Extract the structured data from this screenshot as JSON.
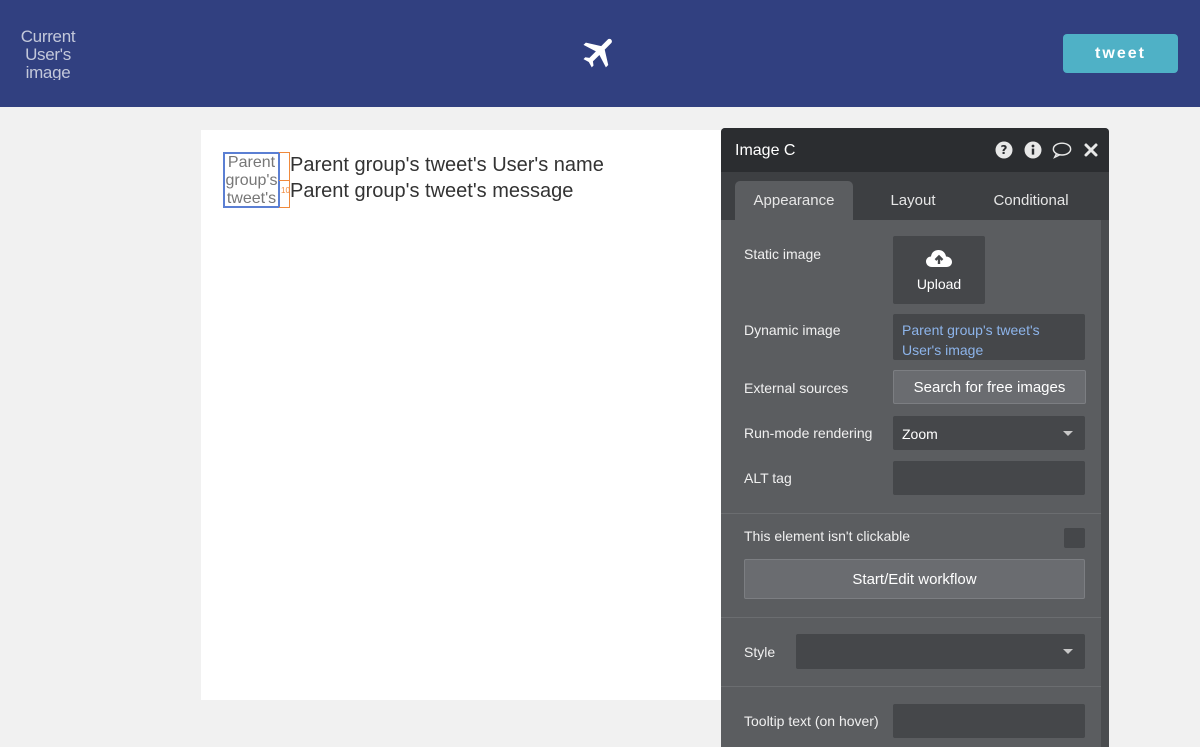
{
  "header": {
    "user_image_text": "Current User's image",
    "logo_icon": "airplane-icon",
    "tweet_button": "tweet"
  },
  "canvas": {
    "thumb_text": "Parent group's tweet's",
    "selection_number": "10",
    "name_text": "Parent group's tweet's User's name",
    "message_text": "Parent group's tweet's message"
  },
  "panel": {
    "title": "Image C",
    "tabs": [
      "Appearance",
      "Layout",
      "Conditional"
    ],
    "static_image_label": "Static image",
    "upload_label": "Upload",
    "dynamic_image_label": "Dynamic image",
    "dynamic_image_value": "Parent group's tweet's User's image",
    "external_sources_label": "External sources",
    "search_free_images": "Search for free images",
    "run_mode_label": "Run-mode rendering",
    "run_mode_value": "Zoom",
    "alt_tag_label": "ALT tag",
    "not_clickable_label": "This element isn't clickable",
    "workflow_button": "Start/Edit workflow",
    "style_label": "Style",
    "style_value": "",
    "tooltip_label": "Tooltip text (on hover)",
    "tooltip_value": ""
  },
  "colors": {
    "header_bg": "#314080",
    "tweet_button_bg": "#4fb1c6",
    "panel_bg": "#5b5d60",
    "panel_header_bg": "#2b2d30",
    "dynamic_link": "#8db4ea"
  }
}
